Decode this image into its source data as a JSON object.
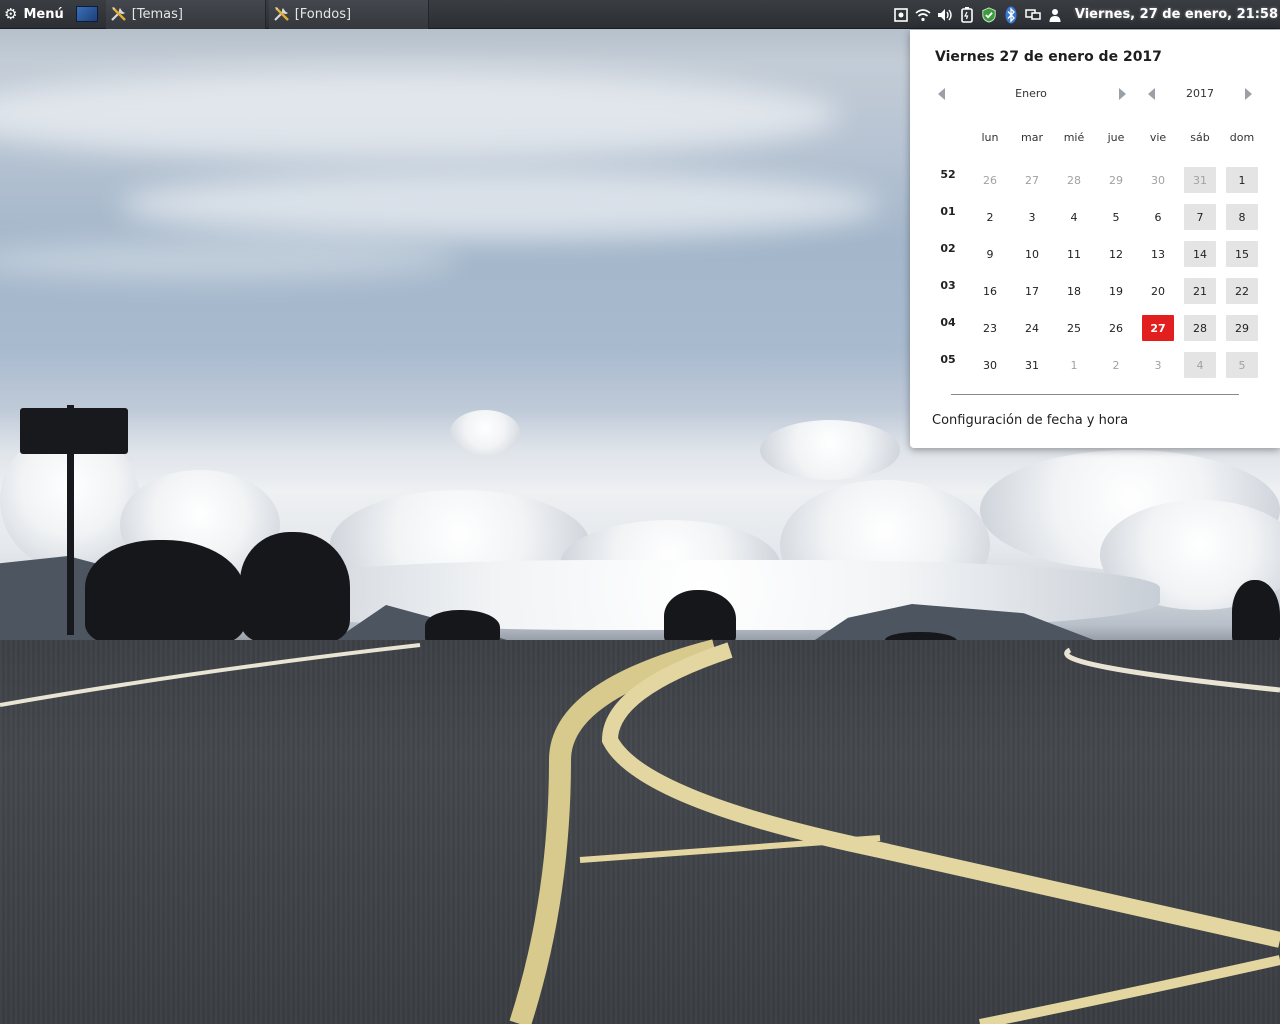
{
  "panel": {
    "menu_label": "Menú",
    "menu_icon": "gear-icon",
    "show_desktop_icon": "desktop-icon",
    "taskbar": [
      {
        "label": "[Temas]",
        "icon": "tools-icon"
      },
      {
        "label": "[Fondos]",
        "icon": "tools-icon"
      }
    ],
    "tray_icons": [
      "screenshot-icon",
      "wifi-icon",
      "volume-icon",
      "battery-icon",
      "shield-icon",
      "bluetooth-icon",
      "display-icon",
      "user-icon"
    ],
    "clock": "Viernes, 27 de enero, 21:58"
  },
  "calendar": {
    "date_title": "Viernes 27 de enero de 2017",
    "month": "Enero",
    "year": "2017",
    "weekdays": [
      "lun",
      "mar",
      "mié",
      "jue",
      "vie",
      "sáb",
      "dom"
    ],
    "weeks": [
      {
        "num": "52",
        "days": [
          "26",
          "27",
          "28",
          "29",
          "30",
          "31",
          "1"
        ]
      },
      {
        "num": "01",
        "days": [
          "2",
          "3",
          "4",
          "5",
          "6",
          "7",
          "8"
        ]
      },
      {
        "num": "02",
        "days": [
          "9",
          "10",
          "11",
          "12",
          "13",
          "14",
          "15"
        ]
      },
      {
        "num": "03",
        "days": [
          "16",
          "17",
          "18",
          "19",
          "20",
          "21",
          "22"
        ]
      },
      {
        "num": "04",
        "days": [
          "23",
          "24",
          "25",
          "26",
          "27",
          "28",
          "29"
        ]
      },
      {
        "num": "05",
        "days": [
          "30",
          "31",
          "1",
          "2",
          "3",
          "4",
          "5"
        ]
      }
    ],
    "today": "27",
    "today_color": "#e21e1e",
    "settings_link": "Configuración de fecha y hora"
  }
}
